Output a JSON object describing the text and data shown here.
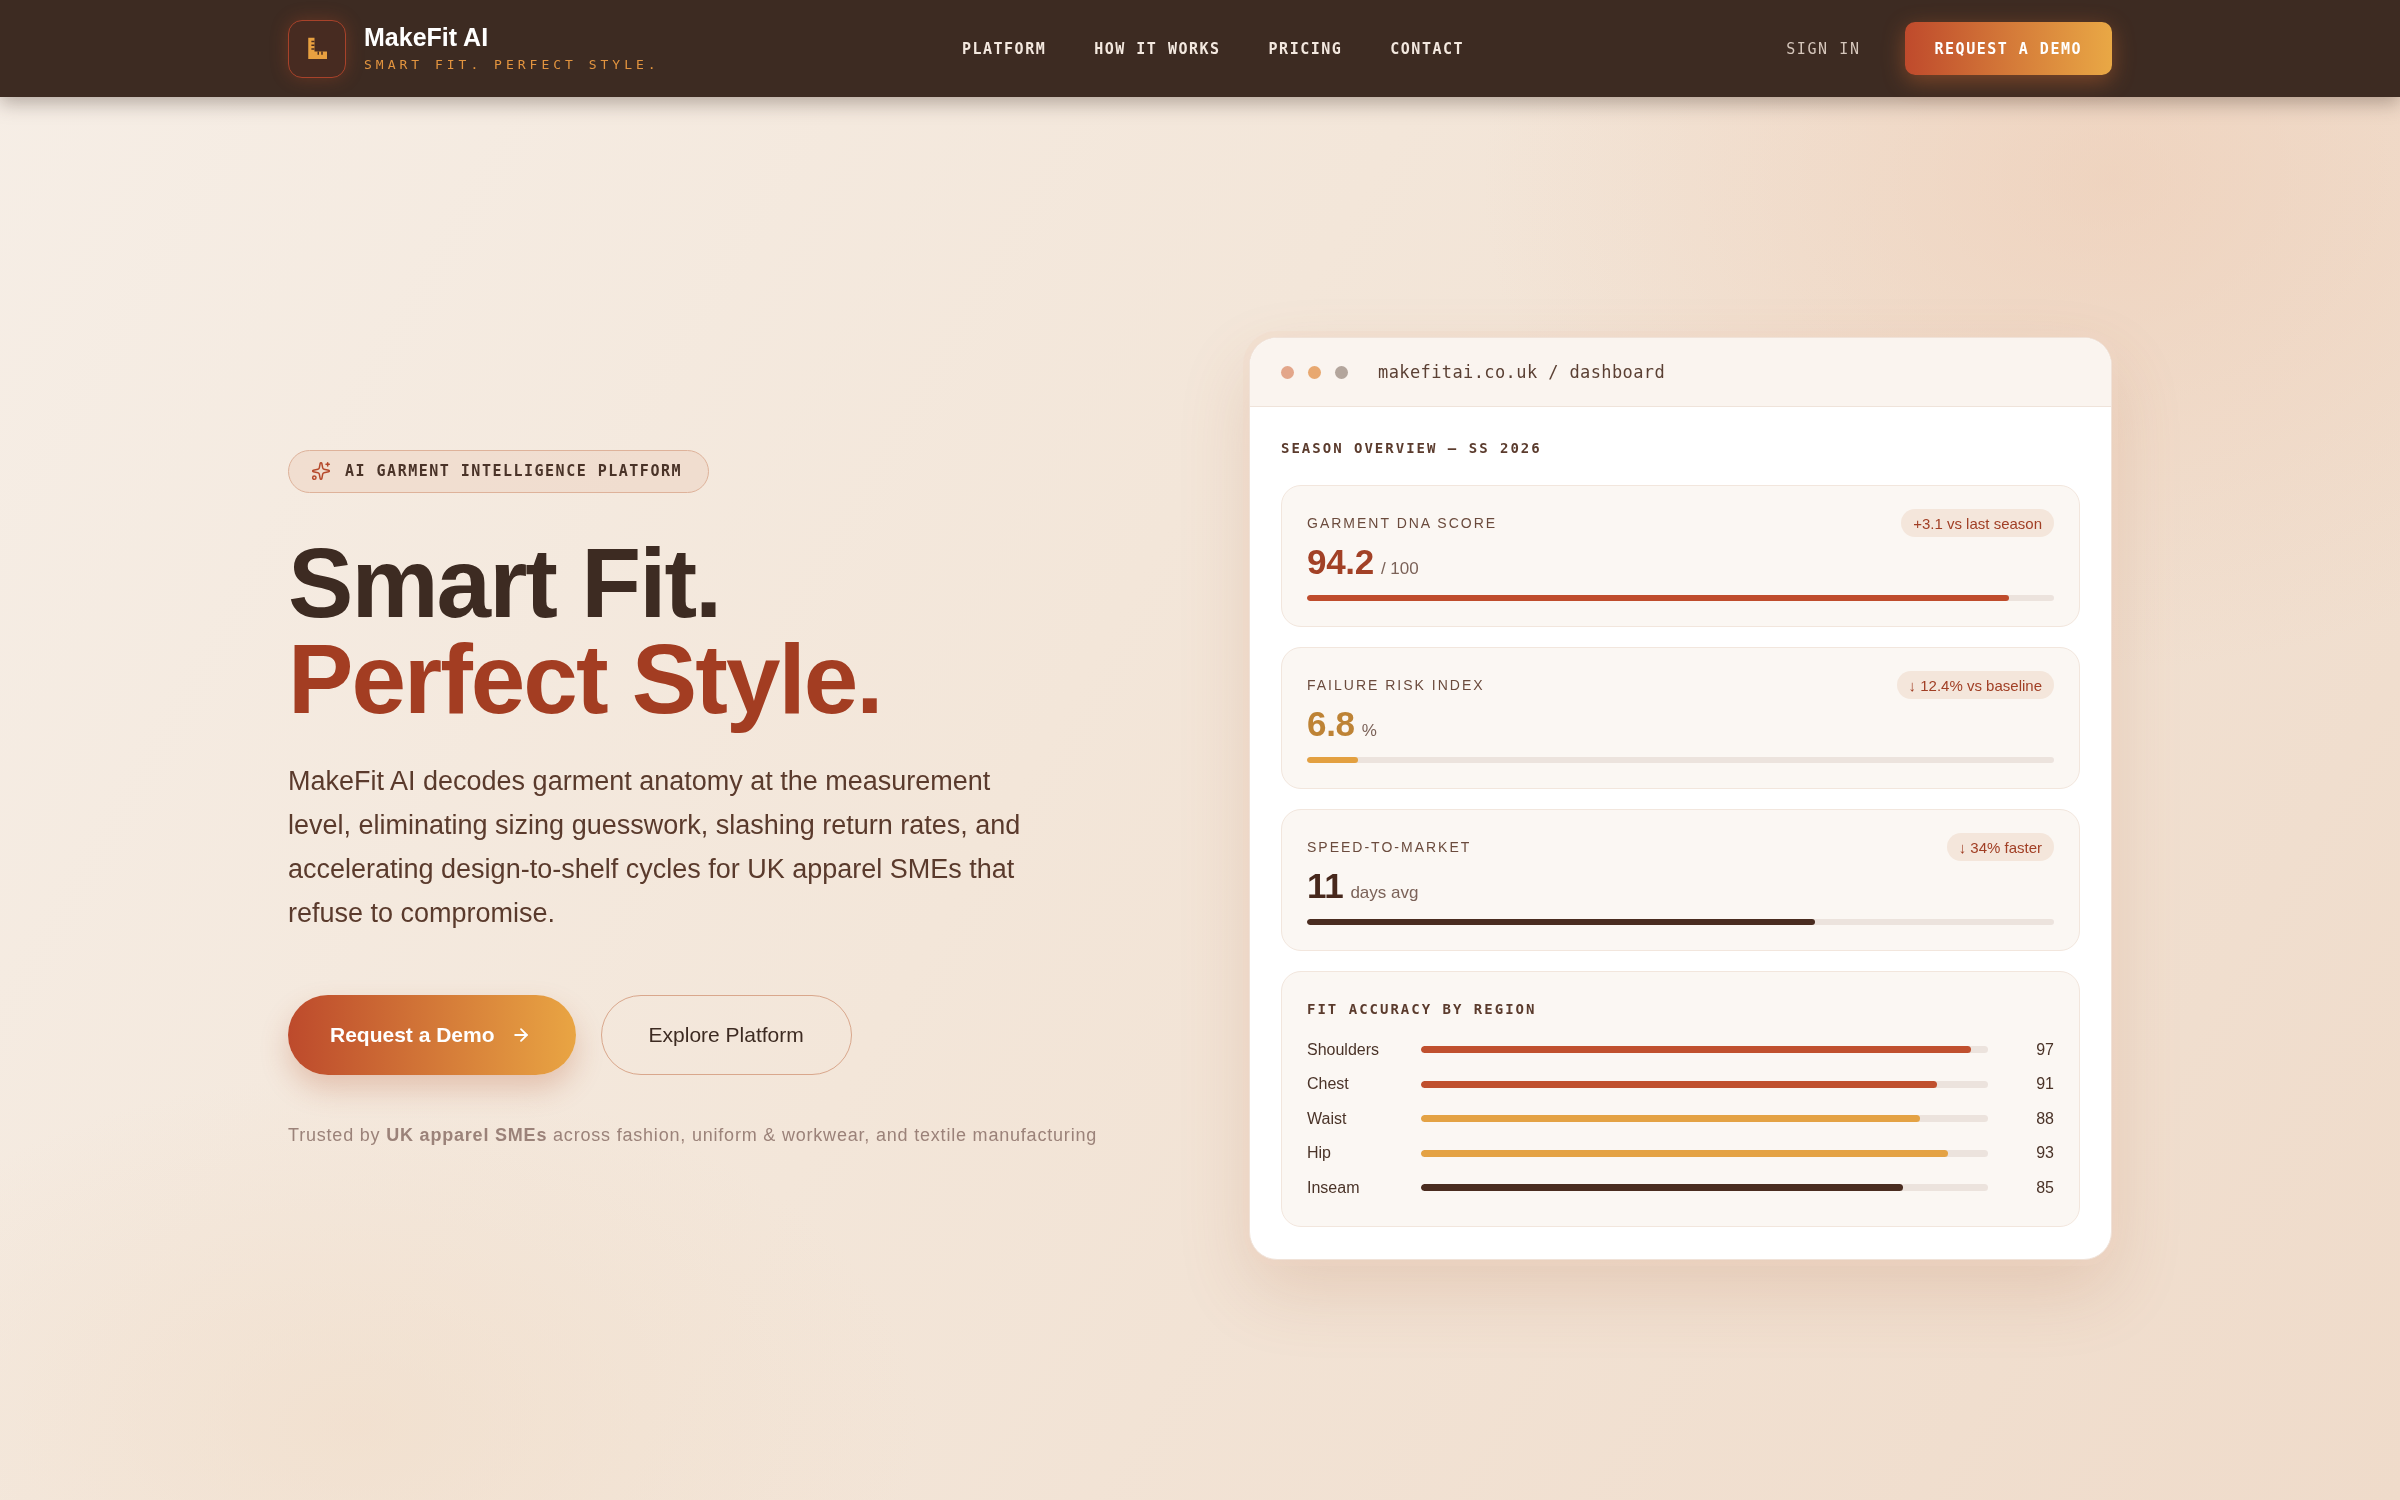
{
  "nav": {
    "brand": {
      "name": "MakeFit AI",
      "tagline": "SMART FIT. PERFECT STYLE."
    },
    "links": [
      "PLATFORM",
      "HOW IT WORKS",
      "PRICING",
      "CONTACT"
    ],
    "sign_in": "SIGN IN",
    "cta": "REQUEST A DEMO"
  },
  "hero": {
    "badge": "AI GARMENT INTELLIGENCE PLATFORM",
    "heading": [
      "Smart Fit.",
      "Perfect Style."
    ],
    "description": "MakeFit AI decodes garment anatomy at the measurement level, eliminating sizing guesswork, slashing return rates, and accelerating design-to-shelf cycles for UK apparel SMEs that refuse to compromise.",
    "buttons": [
      {
        "label": "Request a Demo",
        "kind": "primary"
      },
      {
        "label": "Explore Platform",
        "kind": "secondary"
      }
    ],
    "trust_note": "Trusted by **UK apparel SMEs** across fashion, uniform & workwear, and textile manufacturing"
  },
  "dashboard": {
    "window_dots": [
      {
        "color": "#e3a68a"
      },
      {
        "color": "#e8a870"
      },
      {
        "color": "#b3a59c"
      }
    ],
    "url": "makefitai.co.uk / dashboard",
    "section_title": "SEASON OVERVIEW — SS 2026",
    "metrics": [
      {
        "label": "GARMENT DNA SCORE",
        "trend": "+3.1 vs last season",
        "value": "94.2",
        "unit": "/ 100",
        "level": 0.94,
        "color": "#bf4c2c"
      },
      {
        "label": "FAILURE RISK INDEX",
        "trend": "↓ 12.4% vs baseline",
        "value": "6.8",
        "unit": "%",
        "level": 0.068,
        "color": "#e3a040"
      },
      {
        "label": "SPEED-TO-MARKET",
        "trend": "↓ 34% faster",
        "value": "11",
        "unit": "days avg",
        "level": 0.68,
        "color": "#4a2c20"
      }
    ],
    "fit_accuracy": {
      "title": "FIT ACCURACY BY REGION",
      "regions": [
        {
          "name": "Shoulders",
          "value": "97",
          "level": 0.97,
          "color": "#c0502e"
        },
        {
          "name": "Chest",
          "value": "91",
          "level": 0.91,
          "color": "#c0502e"
        },
        {
          "name": "Waist",
          "value": "88",
          "level": 0.88,
          "color": "#e4a244"
        },
        {
          "name": "Hip",
          "value": "93",
          "level": 0.93,
          "color": "#e4a244"
        },
        {
          "name": "Inseam",
          "value": "85",
          "level": 0.85,
          "color": "#4a2c20"
        }
      ]
    }
  }
}
